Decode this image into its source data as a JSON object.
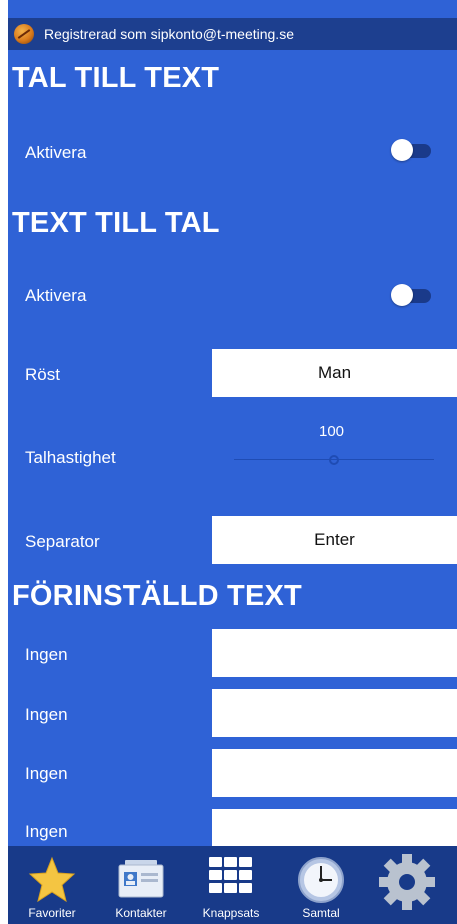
{
  "status": {
    "registered_text": "Registrerad som sipkonto@t-meeting.se"
  },
  "sections": {
    "tal_till_text": {
      "title": "TAL TILL TEXT",
      "activate_label": "Aktivera"
    },
    "text_till_tal": {
      "title": "TEXT TILL TAL",
      "activate_label": "Aktivera",
      "voice_label": "Röst",
      "voice_value": "Man",
      "speed_label": "Talhastighet",
      "speed_value": "100",
      "separator_label": "Separator",
      "separator_value": "Enter"
    },
    "forinstalld_text": {
      "title": "FÖRINSTÄLLD TEXT",
      "items": [
        {
          "label": "Ingen",
          "value": ""
        },
        {
          "label": "Ingen",
          "value": ""
        },
        {
          "label": "Ingen",
          "value": ""
        },
        {
          "label": "Ingen",
          "value": ""
        }
      ]
    }
  },
  "nav": [
    {
      "label": "Favoriter",
      "icon": "star-icon"
    },
    {
      "label": "Kontakter",
      "icon": "contacts-icon"
    },
    {
      "label": "Knappsats",
      "icon": "keypad-icon"
    },
    {
      "label": "Samtal",
      "icon": "clock-icon"
    },
    {
      "label": "",
      "icon": "gear-icon"
    }
  ],
  "colors": {
    "background": "#2f62d6",
    "statusbar": "#1d3f8f",
    "bottombar": "#183a89",
    "toggle_track": "#1a3a8a"
  },
  "toggles": {
    "tal_till_text_enabled": false,
    "text_till_tal_enabled": false
  }
}
